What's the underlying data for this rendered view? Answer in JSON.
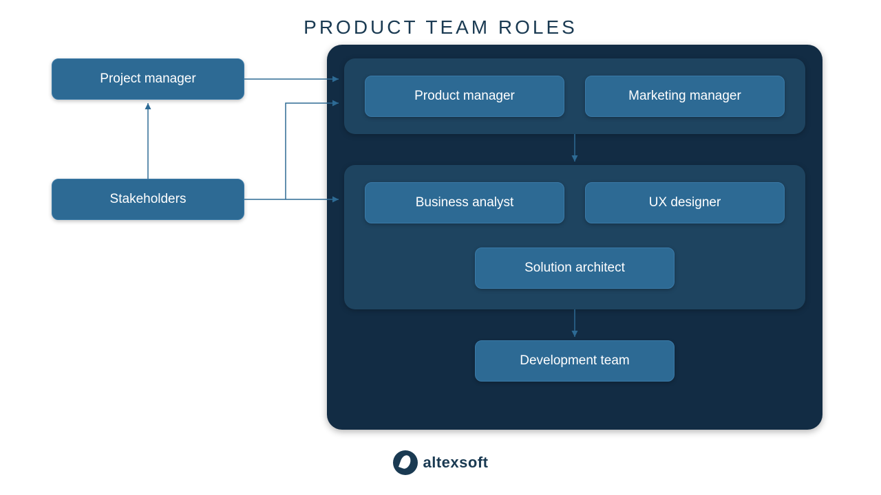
{
  "title": "PRODUCT TEAM ROLES",
  "external_roles": {
    "project_manager": "Project manager",
    "stakeholders": "Stakeholders"
  },
  "product_team": {
    "top_group": {
      "product_manager": "Product manager",
      "marketing_manager": "Marketing manager"
    },
    "middle_group": {
      "business_analyst": "Business analyst",
      "ux_designer": "UX designer",
      "solution_architect": "Solution architect"
    },
    "development_team": "Development team"
  },
  "brand": "altexsoft",
  "colors": {
    "role_box": "#2d6a94",
    "outer_container": "#122c44",
    "inner_group": "#1e4460",
    "text_title": "#1a3a52",
    "arrow": "#2d6a94"
  }
}
